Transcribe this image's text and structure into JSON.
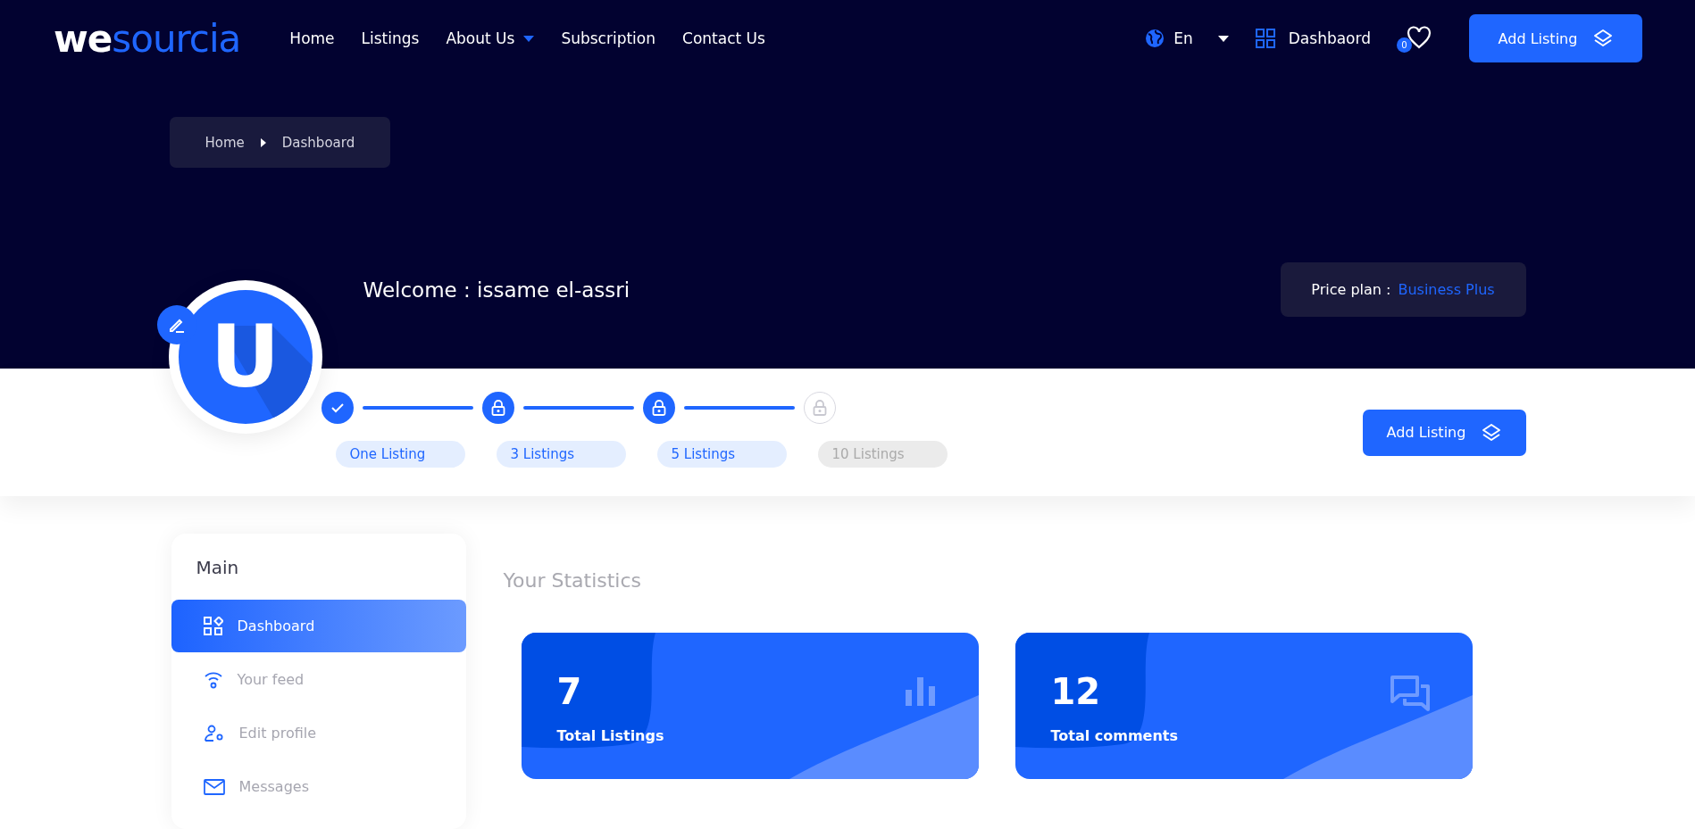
{
  "logo": {
    "lead": "we",
    "rest": "sourcia"
  },
  "nav": [
    {
      "label": "Home",
      "dropdown": false
    },
    {
      "label": "Listings",
      "dropdown": false
    },
    {
      "label": "About Us",
      "dropdown": true
    },
    {
      "label": "Subscription",
      "dropdown": false
    },
    {
      "label": "Contact Us",
      "dropdown": false
    }
  ],
  "language": "En",
  "dashboard_link": "Dashbaord",
  "favorites_count": "0",
  "header_button": "Add Listing",
  "breadcrumb": [
    "Home",
    "Dashboard"
  ],
  "welcome": "Welcome : issame el-assri",
  "price_plan": {
    "label": "Price plan :",
    "value": "Business Plus"
  },
  "avatar_letter": "U",
  "steps": [
    {
      "label": "One Listing",
      "kind": "check",
      "disabled": false
    },
    {
      "label": "3 Listings",
      "kind": "lock",
      "disabled": false
    },
    {
      "label": "5 Listings",
      "kind": "lock",
      "disabled": false
    },
    {
      "label": "10 Listings",
      "kind": "lock",
      "disabled": true
    }
  ],
  "band_button": "Add Listing",
  "sidebar": {
    "title": "Main",
    "items": [
      {
        "label": "Dashboard",
        "kind": "dashboard",
        "selected": true
      },
      {
        "label": "Your feed",
        "kind": "feed",
        "selected": false
      },
      {
        "label": "Edit profile",
        "kind": "profile",
        "selected": false
      },
      {
        "label": "Messages",
        "kind": "messages",
        "selected": false
      }
    ]
  },
  "statistics": {
    "title": "Your Statistics",
    "cards": [
      {
        "value": "7",
        "label": "Total Listings",
        "kind": "chart"
      },
      {
        "value": "12",
        "label": "Total comments",
        "kind": "comments"
      }
    ]
  }
}
